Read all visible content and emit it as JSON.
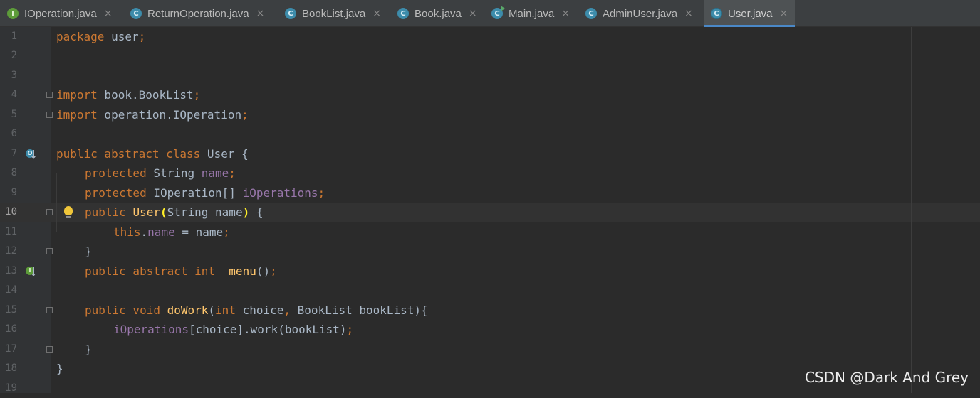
{
  "tabs": [
    {
      "label": "IOperation.java",
      "icon": "interface-icon",
      "icon_letter": "I",
      "active": false
    },
    {
      "label": "ReturnOperation.java",
      "icon": "class-icon",
      "icon_letter": "C",
      "active": false
    },
    {
      "label": "BookList.java",
      "icon": "class-icon",
      "icon_letter": "C",
      "active": false
    },
    {
      "label": "Book.java",
      "icon": "class-icon",
      "icon_letter": "C",
      "active": false
    },
    {
      "label": "Main.java",
      "icon": "runnable-class-icon",
      "icon_letter": "C",
      "active": false
    },
    {
      "label": "AdminUser.java",
      "icon": "class-icon",
      "icon_letter": "C",
      "active": false
    },
    {
      "label": "User.java",
      "icon": "abstract-class-icon",
      "icon_letter": "C",
      "active": true
    }
  ],
  "tab_close_glyph": "×",
  "line_numbers": [
    "1",
    "2",
    "3",
    "4",
    "5",
    "6",
    "7",
    "8",
    "9",
    "10",
    "11",
    "12",
    "13",
    "14",
    "15",
    "16",
    "17",
    "18",
    "19"
  ],
  "current_line": "10",
  "code": {
    "l1": {
      "kw": "package",
      "rest": " user",
      "semi": ";"
    },
    "l4": {
      "kw": "import",
      "rest": " book.BookList",
      "semi": ";"
    },
    "l5": {
      "kw": "import",
      "rest": " operation.IOperation",
      "semi": ";"
    },
    "l7": {
      "kw": "public abstract class",
      "rest": " User {"
    },
    "l8": {
      "kw": "protected",
      "type": " String ",
      "field": "name",
      "semi": ";"
    },
    "l9": {
      "kw": "protected",
      "type": " IOperation[] ",
      "field": "iOperations",
      "semi": ";"
    },
    "l10": {
      "kw": "public",
      "method": "User",
      "open": "(",
      "params": "String name",
      "close": ")",
      "rest": " {"
    },
    "l11": {
      "kw": "this",
      "dot": ".",
      "field": "name",
      "rest": " = name",
      "semi": ";"
    },
    "l12": {
      "rest": "}"
    },
    "l13": {
      "kw": "public abstract int",
      "method": "menu",
      "rest": "()",
      "semi": ";"
    },
    "l15": {
      "kw": "public void",
      "method": "doWork",
      "open": "(",
      "kw2": "int",
      "p1": " choice",
      "comma": ",",
      "p2": " BookList bookList){"
    },
    "l16": {
      "field": "iOperations",
      "rest": "[choice].work(bookList)",
      "semi": ";"
    },
    "l17": {
      "rest": "}"
    },
    "l18": {
      "rest": "}"
    }
  },
  "gutter_marks": {
    "l7": {
      "icon": "overridden-icon",
      "letter": "O"
    },
    "l13": {
      "icon": "implemented-icon",
      "letter": "I"
    }
  },
  "watermark": "CSDN @Dark And Grey",
  "colors": {
    "keyword": "#cc7832",
    "field": "#9876aa",
    "method": "#ffc66d",
    "text": "#a9b7c6",
    "accent": "#4a88c7"
  }
}
